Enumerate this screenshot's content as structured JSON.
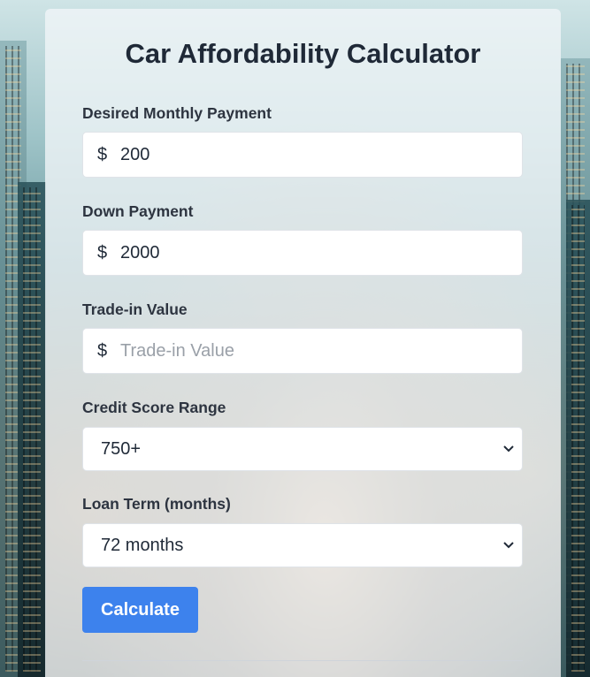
{
  "form": {
    "title": "Car Affordability Calculator",
    "monthly_payment": {
      "label": "Desired Monthly Payment",
      "prefix": "$",
      "value": "200",
      "placeholder": "Desired Monthly Payment"
    },
    "down_payment": {
      "label": "Down Payment",
      "prefix": "$",
      "value": "2000",
      "placeholder": "Down Payment"
    },
    "trade_in": {
      "label": "Trade-in Value",
      "prefix": "$",
      "value": "",
      "placeholder": "Trade-in Value"
    },
    "credit_score": {
      "label": "Credit Score Range",
      "selected": "750+"
    },
    "loan_term": {
      "label": "Loan Term (months)",
      "selected": "72 months"
    },
    "calculate_label": "Calculate"
  },
  "colors": {
    "button": "#3d82ed",
    "title": "#1f2937"
  }
}
